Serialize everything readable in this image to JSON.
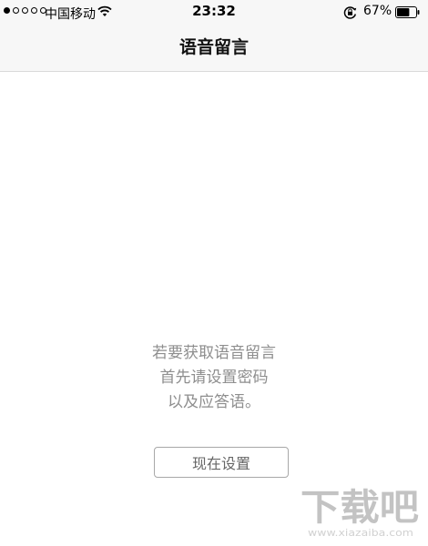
{
  "status_bar": {
    "carrier": "中国移动",
    "time": "23:32",
    "battery_percent": "67%",
    "signal_filled": 1,
    "signal_total": 5,
    "icons": [
      "signal-dots-icon",
      "wifi-icon",
      "rotation-lock-icon",
      "battery-icon"
    ]
  },
  "nav": {
    "title": "语音留言"
  },
  "main": {
    "message_lines": [
      "若要获取语音留言",
      "首先请设置密码",
      "以及应答语。"
    ],
    "setup_button_label": "现在设置"
  },
  "watermark": {
    "text": "下载吧",
    "subtext": "www.xiazaiba.com"
  },
  "colors": {
    "bar_background": "#f7f7f7",
    "message_text": "#8e8e8e",
    "button_border": "#a8a8a8"
  }
}
